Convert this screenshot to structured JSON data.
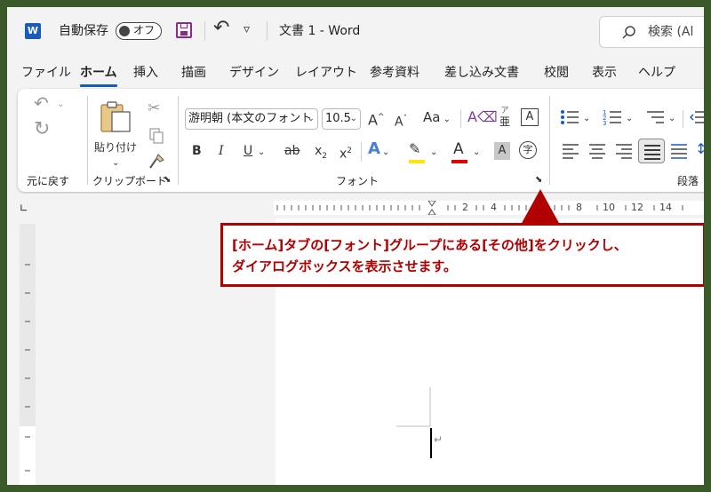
{
  "titlebar": {
    "app_letter": "W",
    "autosave_label": "自動保存",
    "autosave_state": "オフ",
    "undo_glyph": "↶",
    "customize_glyph": "▿",
    "doc_title": "文書 1  -  Word",
    "search_placeholder": "検索 (Al"
  },
  "menu": {
    "tabs": [
      "ファイル",
      "ホーム",
      "挿入",
      "描画",
      "デザイン",
      "レイアウト",
      "参考資料",
      "差し込み文書",
      "校閲",
      "表示",
      "ヘルプ"
    ],
    "active": "ホーム"
  },
  "ribbon": {
    "undo_group_label": "元に戻す",
    "clipboard": {
      "paste_label": "貼り付け",
      "group_label": "クリップボード"
    },
    "font": {
      "font_name": "游明朝 (本文のフォント",
      "font_size": "10.5",
      "group_label": "フォント",
      "grow": "A",
      "shrink": "A",
      "case": "Aa",
      "phonetic_top": "ア",
      "phonetic_bottom": "亜",
      "border_char": "A",
      "bold": "B",
      "italic": "I",
      "underline": "U",
      "strike": "ab",
      "subscript": "x",
      "superscript": "x",
      "effect": "A",
      "highlight": "✎",
      "color": "A",
      "shade": "A",
      "enclose": "字"
    },
    "paragraph": {
      "group_label": "段落"
    }
  },
  "ruler": {
    "numbers": [
      "2",
      "4",
      "8",
      "10",
      "12",
      "14"
    ]
  },
  "callout": {
    "line1": "[ホーム]タブの[フォント]グループにある[その他]をクリックし、",
    "line2": "ダイアログボックスを表示させます。"
  },
  "colors": {
    "accent": "#185abd",
    "callout_red": "#b00000",
    "frame_green": "#3a5a2a"
  }
}
